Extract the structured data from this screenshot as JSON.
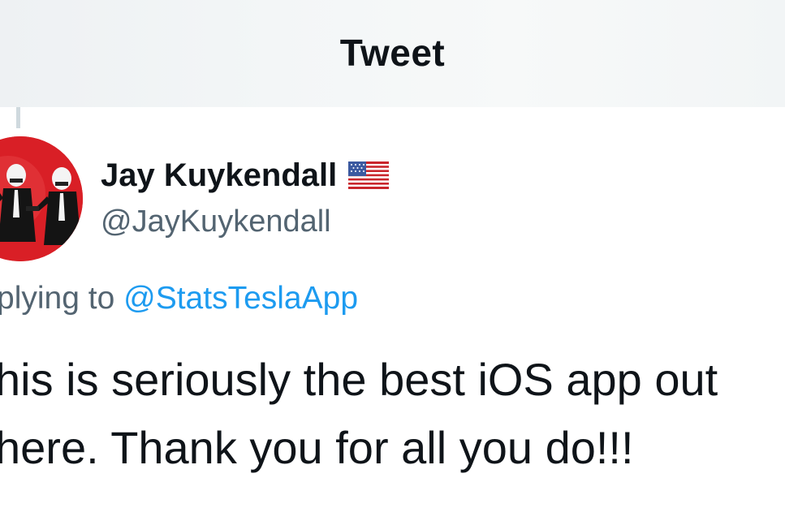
{
  "header": {
    "title": "Tweet"
  },
  "tweet": {
    "author": {
      "name": "Jay Kuykendall",
      "handle": "@JayKuykendall",
      "flag_icon": "us-flag-icon",
      "avatar_icon": "stormtrooper-avatar"
    },
    "replying_prefix": "plying to",
    "replying_to": "@StatsTeslaApp",
    "text_lines": [
      "his is seriously the best iOS app out",
      "here. Thank you for all you do!!!"
    ]
  },
  "colors": {
    "text_primary": "#0f1419",
    "text_secondary": "#536471",
    "link": "#1d9bf0",
    "avatar_bg": "#d91f26"
  }
}
